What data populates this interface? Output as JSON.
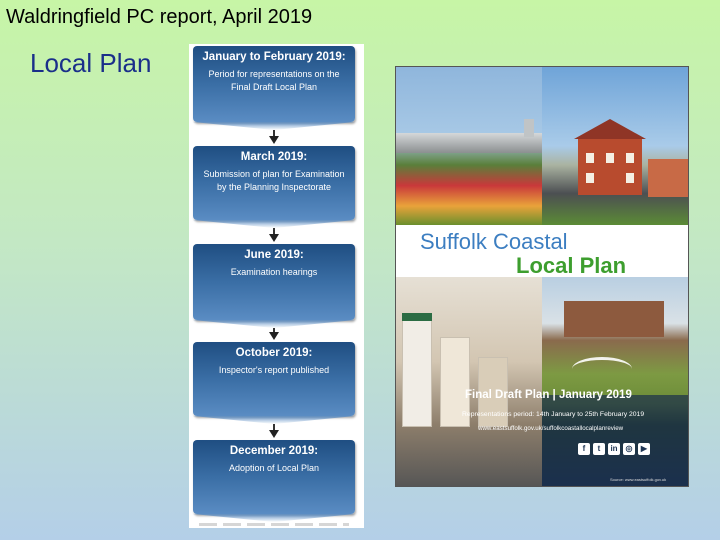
{
  "header": {
    "title": "Waldringfield PC report, April 2019"
  },
  "section": {
    "title": "Local Plan"
  },
  "timeline": {
    "stages": [
      {
        "date": "January to February 2019:",
        "description": "Period for representations on the Final Draft Local Plan"
      },
      {
        "date": "March 2019:",
        "description": "Submission of plan for Examination by the Planning Inspectorate"
      },
      {
        "date": "June 2019:",
        "description": "Examination hearings"
      },
      {
        "date": "October 2019:",
        "description": "Inspector's report published"
      },
      {
        "date": "December 2019:",
        "description": "Adoption of Local Plan"
      }
    ]
  },
  "cover": {
    "title_line1": "Suffolk Coastal",
    "title_line2": "Local Plan",
    "subtitle": "Final Draft Plan | January 2019",
    "representations": "Representations period: 14th January to 25th February 2019",
    "url": "www.eastsuffolk.gov.uk/suffolkcoastallocalplanreview",
    "social_icons": [
      "facebook-icon",
      "twitter-icon",
      "linkedin-icon",
      "instagram-icon",
      "youtube-icon"
    ],
    "source": "Source: www.eastsuffolk.gov.uk"
  },
  "colors": {
    "section_title": "#1a2f8a",
    "stage_box": "#3a6ea5",
    "cover_blue": "#3c7ec1",
    "cover_green": "#3d9e2e"
  }
}
